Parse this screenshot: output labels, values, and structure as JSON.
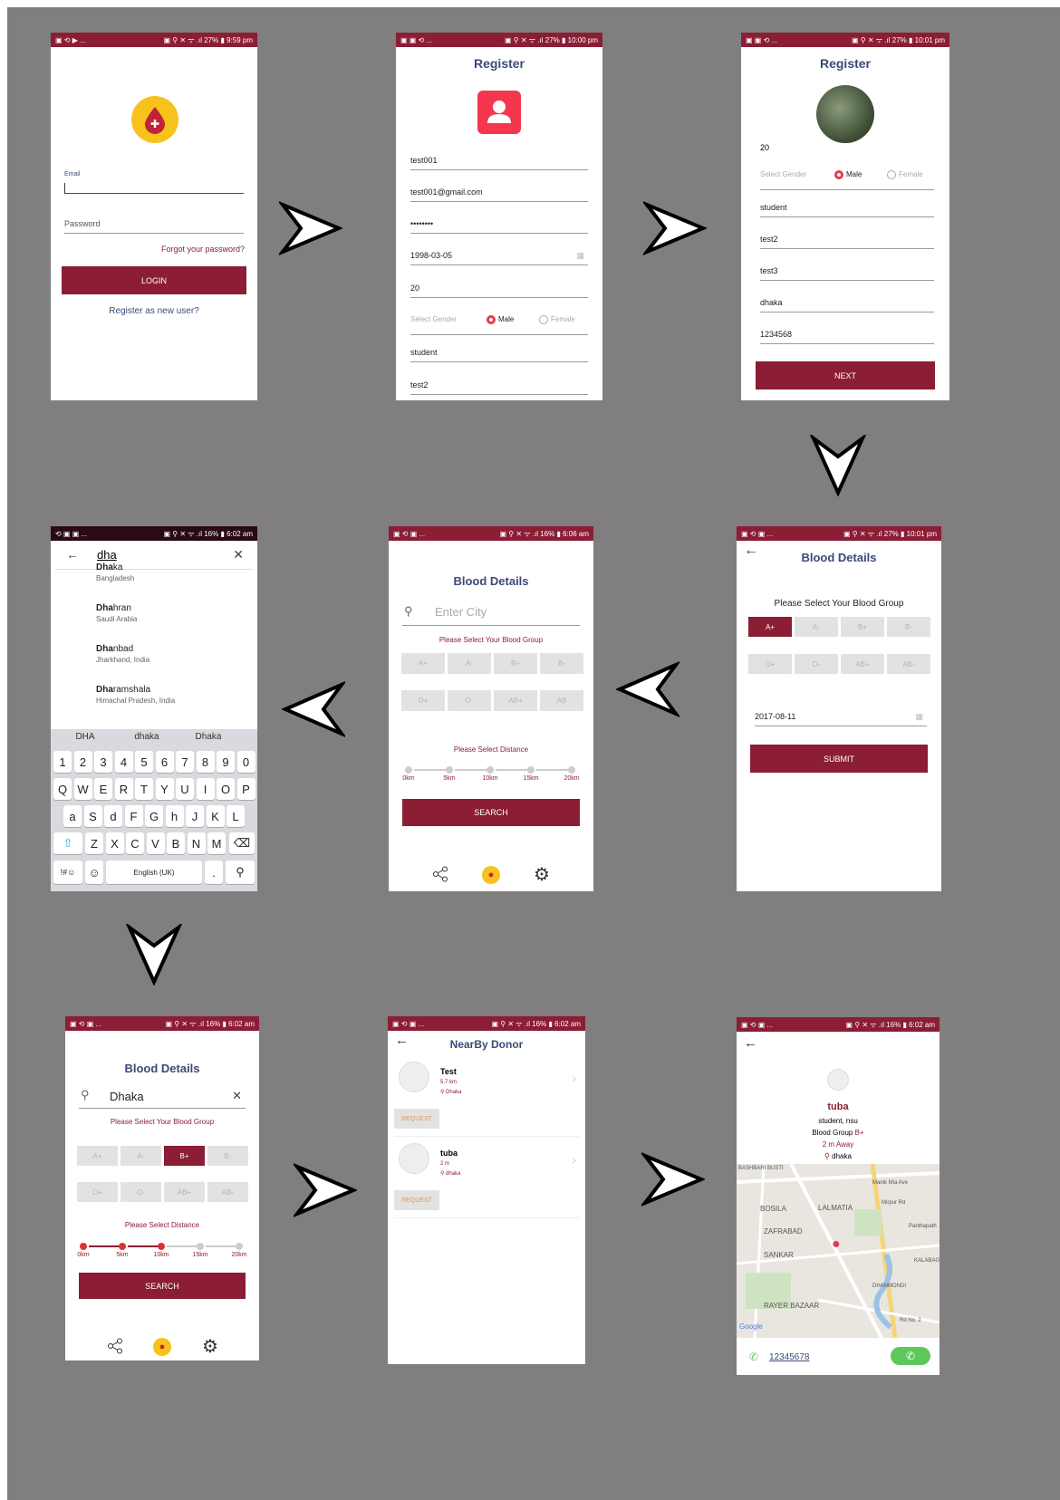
{
  "colors": {
    "accent": "#8b1d34",
    "title": "#3a4a78",
    "canvas": "#807e7f",
    "call": "#5cc85a"
  },
  "s1": {
    "status_left": "▣ ⟲ ▶ ...",
    "status_right": "▣ ⚲ ✕ ᯤ .ıl 27% ▮ 9:59 pm",
    "email_label": "Email",
    "password_label": "Password",
    "forgot": "Forgot your password?",
    "login": "LOGIN",
    "register": "Register as new user?"
  },
  "s2": {
    "status_left": "▣ ▣ ⟲ ...",
    "status_right": "▣ ⚲ ✕ ᯤ .ıl 27% ▮ 10:00 pm",
    "title": "Register",
    "username": "test001",
    "email": "test001@gmail.com",
    "password": "••••••••",
    "dob": "1998-03-05",
    "age": "20",
    "gender_label": "Select Gender",
    "male": "Male",
    "female": "Female",
    "occupation": "student",
    "f1": "test2"
  },
  "s3": {
    "status_left": "▣ ▣ ⟲ ...",
    "status_right": "▣ ⚲ ✕ ᯤ .ıl 27% ▮ 10:01 pm",
    "title": "Register",
    "age": "20",
    "gender_label": "Select Gender",
    "male": "Male",
    "female": "Female",
    "occupation": "student",
    "f1": "test2",
    "f2": "test3",
    "city": "dhaka",
    "phone": "1234568",
    "next": "NEXT"
  },
  "s4": {
    "status_left": "▣ ⟲ ▣ ...",
    "status_right": "▣ ⚲ ✕ ᯤ .ıl 27% ▮ 10:01 pm",
    "title": "Blood Details",
    "prompt": "Please Select Your Blood Group",
    "groups": [
      "A+",
      "A-",
      "B+",
      "B-",
      "O+",
      "O-",
      "AB+",
      "AB-"
    ],
    "date": "2017-08-11",
    "submit": "SUBMIT"
  },
  "s5": {
    "status_left": "▣ ⟲ ▣ ...",
    "status_right": "▣ ⚲ ✕ ᯤ .ıl 16% ▮ 6:06 am",
    "title": "Blood Details",
    "city_placeholder": "Enter City",
    "prompt": "Please Select Your Blood Group",
    "groups": [
      "A+",
      "A-",
      "B+",
      "B-",
      "O+",
      "O-",
      "AB+",
      "AB"
    ],
    "distance_label": "Please Select Distance",
    "ticks": [
      "0km",
      "5km",
      "10km",
      "15km",
      "20km"
    ],
    "search": "SEARCH"
  },
  "s6": {
    "status_left": "⟲ ▣ ▣ ...",
    "status_right": "▣ ⚲ ✕ ᯤ .ıl 16% ▮ 6:02 am",
    "query": "dha",
    "results": [
      {
        "match": "Dha",
        "rest": "ka",
        "sub": "Bangladesh"
      },
      {
        "match": "Dha",
        "rest": "hran",
        "sub": "Saudi Arabia"
      },
      {
        "match": "Dha",
        "rest": "nbad",
        "sub": "Jharkhand, India"
      },
      {
        "match": "Dha",
        "rest": "ramshala",
        "sub": "Himachal Pradesh, India"
      }
    ],
    "suggestions": [
      "DHA",
      "dhaka",
      "Dhaka"
    ],
    "row1": [
      "1",
      "2",
      "3",
      "4",
      "5",
      "6",
      "7",
      "8",
      "9",
      "0"
    ],
    "row2": [
      "Q",
      "W",
      "E",
      "R",
      "T",
      "Y",
      "U",
      "I",
      "O",
      "P"
    ],
    "row3": [
      "a",
      "S",
      "d",
      "F",
      "G",
      "h",
      "J",
      "K",
      "L"
    ],
    "row4": [
      "Z",
      "X",
      "C",
      "V",
      "B",
      "N",
      "M"
    ],
    "sym": "!#☺",
    "lang": "English (UK)",
    "dotkey": "."
  },
  "s7": {
    "status_left": "▣ ⟲ ▣ ...",
    "status_right": "▣ ⚲ ✕ ᯤ .ıl 16% ▮ 6:02 am",
    "title": "Blood Details",
    "city": "Dhaka",
    "prompt": "Please Select Your Blood Group",
    "groups": [
      "A+",
      "A-",
      "B+",
      "B-",
      "O+",
      "O-",
      "AB+",
      "AB-"
    ],
    "distance_label": "Please Select Distance",
    "ticks": [
      "0km",
      "5km",
      "10km",
      "15km",
      "20km"
    ],
    "search": "SEARCH"
  },
  "s8": {
    "status_left": "▣ ⟲ ▣ ...",
    "status_right": "▣ ⚲ ✕ ᯤ .ıl 16% ▮ 6:02 am",
    "title": "NearBy Donor",
    "donors": [
      {
        "name": "Test",
        "dist": "5.7 km",
        "loc": "Dhaka",
        "request": "REQUEST"
      },
      {
        "name": "tuba",
        "dist": "2 m",
        "loc": "dhaka",
        "request": "REQUEST"
      }
    ]
  },
  "s9": {
    "status_left": "▣ ⟲ ▣ ...",
    "status_right": "▣ ⚲ ✕ ᯤ .ıl 16% ▮ 6:02 am",
    "name": "tuba",
    "occupation": "student, nsu",
    "blood_prefix": "Blood Group ",
    "blood": "B+",
    "away": "2 m Away",
    "loc": "dhaka",
    "phone": "12345678",
    "map_labels": [
      "BASHBARI BUSTI",
      "Manik Mia Ave",
      "BOSILA",
      "LALMATIA",
      "Mirpur Rd",
      "Panthapath",
      "ZAFRABAD",
      "SANKAR",
      "KALABAG",
      "DHANMONDI",
      "RAYER BAZAAR",
      "Rd No. 2",
      "Google"
    ]
  }
}
